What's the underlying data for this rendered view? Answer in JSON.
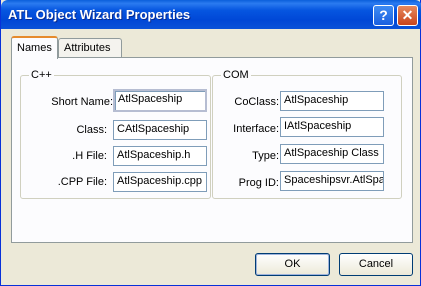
{
  "window": {
    "title": "ATL Object Wizard Properties"
  },
  "titlebar_buttons": {
    "help_icon": "?",
    "close_icon": "✕"
  },
  "tabs": [
    {
      "label": "Names",
      "active": true
    },
    {
      "label": "Attributes",
      "active": false
    }
  ],
  "cpp_group": {
    "title": "C++",
    "fields": [
      {
        "label": "Short Name:",
        "value": "AtlSpaceship"
      },
      {
        "label": "Class:",
        "value": "CAtlSpaceship"
      },
      {
        "label": ".H File:",
        "value": "AtlSpaceship.h"
      },
      {
        "label": ".CPP File:",
        "value": "AtlSpaceship.cpp"
      }
    ]
  },
  "com_group": {
    "title": "COM",
    "fields": [
      {
        "label": "CoClass:",
        "value": "AtlSpaceship"
      },
      {
        "label": "Interface:",
        "value": "IAtlSpaceship"
      },
      {
        "label": "Type:",
        "value": "AtlSpaceship Class"
      },
      {
        "label": "Prog ID:",
        "value": "Spaceshipsvr.AtlSpa"
      }
    ]
  },
  "buttons": {
    "ok": "OK",
    "cancel": "Cancel"
  },
  "colors": {
    "titlebar": "#0054e3",
    "face": "#ece9d8",
    "panel": "#fcfcfe",
    "tab_accent": "#e68b2c"
  }
}
